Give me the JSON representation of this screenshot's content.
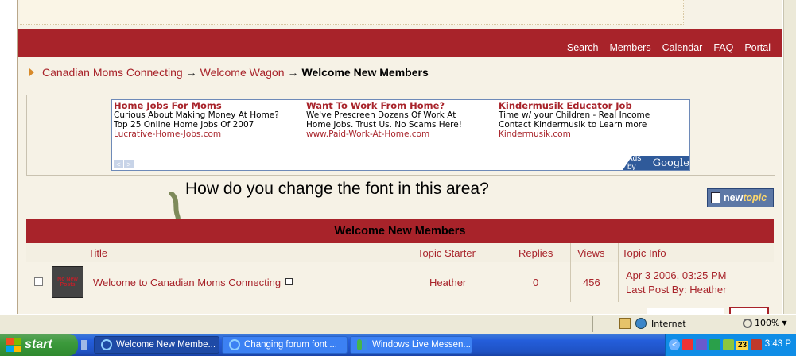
{
  "navbar": {
    "links": [
      "Search",
      "Members",
      "Calendar",
      "FAQ",
      "Portal"
    ]
  },
  "breadcrumb": {
    "items": [
      "Canadian Moms Connecting",
      "Welcome Wagon"
    ],
    "separator": "→",
    "current": "Welcome New Members"
  },
  "ads": [
    {
      "title": "Home Jobs For Moms",
      "line1": "Curious About Making Money At Home?",
      "line2": "Top 25 Online Home Jobs Of 2007",
      "url": "Lucrative-Home-Jobs.com"
    },
    {
      "title": "Want To Work From Home?",
      "line1": "We've Prescreen Dozens Of Work At",
      "line2": "Home Jobs. Trust Us. No Scams Here!",
      "url": "www.Paid-Work-At-Home.com"
    },
    {
      "title": "Kindermusik Educator Job",
      "line1": "Time w/ your Children - Real Income",
      "line2": "Contact Kindermusik to Learn more",
      "url": "Kindermusik.com"
    }
  ],
  "ads_by": {
    "prefix": "Ads by",
    "brand": "Google"
  },
  "annotation": "How do you change the font in this area?",
  "newtopic": {
    "label_a": "new",
    "label_b": "topic"
  },
  "forum": {
    "title": "Welcome New Members",
    "columns": {
      "title": "Title",
      "starter": "Topic Starter",
      "replies": "Replies",
      "views": "Views",
      "info": "Topic Info"
    },
    "rows": [
      {
        "thumb_text": "No New Posts",
        "title": "Welcome to Canadian Moms Connecting",
        "starter": "Heather",
        "replies": "0",
        "views": "456",
        "info_date": "Apr 3 2006, 03:25 PM",
        "info_last": "Last Post By: Heather"
      }
    ]
  },
  "statusbar": {
    "zone": "Internet",
    "zoom": "100%"
  },
  "taskbar": {
    "start": "start",
    "tasks": [
      "Welcome New Membe...",
      "Changing forum font ...",
      "Windows Live Messen..."
    ],
    "tray_badge": "23",
    "clock": "3:43 P"
  }
}
